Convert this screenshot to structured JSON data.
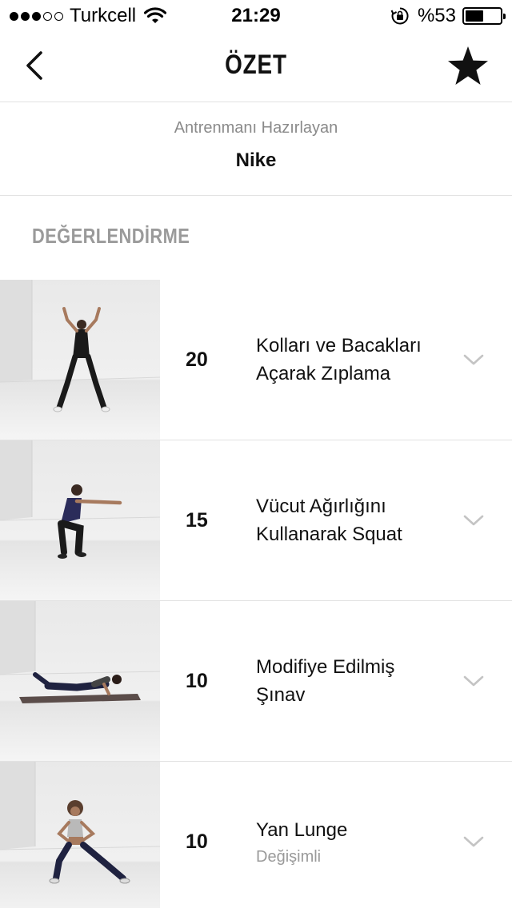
{
  "status_bar": {
    "carrier": "Turkcell",
    "time": "21:29",
    "battery_percent_label": "%53",
    "battery_level": 0.53,
    "signal_bars_filled": 3,
    "signal_bars_total": 5
  },
  "nav": {
    "title": "ÖZET",
    "back_icon": "chevron-left-icon",
    "favorite_icon": "star-icon"
  },
  "author": {
    "label": "Antrenmanı Hazırlayan",
    "name": "Nike"
  },
  "section": {
    "heading": "DEĞERLENDİRME"
  },
  "exercises": [
    {
      "count": "20",
      "name_line1": "Kolları ve Bacakları",
      "name_line2": "Açarak Zıplama",
      "sub": ""
    },
    {
      "count": "15",
      "name_line1": "Vücut Ağırlığını",
      "name_line2": "Kullanarak Squat",
      "sub": ""
    },
    {
      "count": "10",
      "name_line1": "Modifiye Edilmiş",
      "name_line2": "Şınav",
      "sub": ""
    },
    {
      "count": "10",
      "name_line1": "Yan Lunge",
      "name_line2": "",
      "sub": "Değişimli"
    }
  ]
}
